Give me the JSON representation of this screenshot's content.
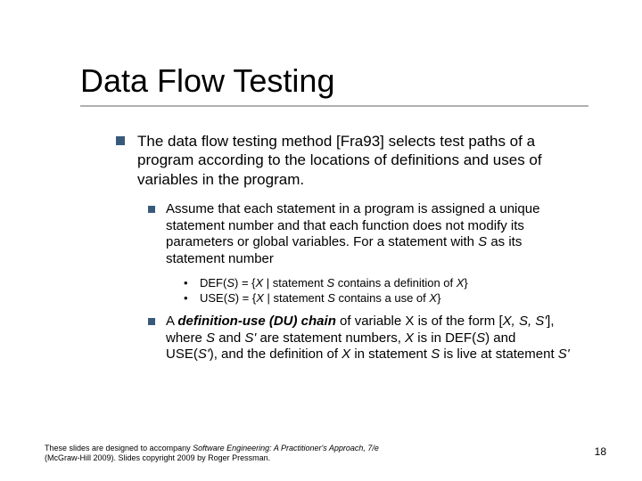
{
  "title": "Data Flow Testing",
  "body": {
    "p1": "The data flow testing method [Fra93] selects test paths of a program according to the locations of definitions and uses of variables in the program.",
    "p2_prefix": "Assume that each statement in a program is assigned a unique statement number and that each function does not modify its parameters or global variables. For a statement with ",
    "p2_S": "S",
    "p2_suffix": " as its statement number",
    "def_prefix": "DEF(",
    "def_S1": "S",
    "def_mid": ") = {",
    "def_X1": "X",
    "def_mid2": " | statement ",
    "def_S2": "S",
    "def_mid3": " contains a definition of ",
    "def_X2": "X",
    "def_end": "}",
    "use_prefix": "USE(",
    "use_S1": "S",
    "use_mid": ") = {",
    "use_X1": "X",
    "use_mid2": " | statement ",
    "use_S2": "S",
    "use_mid3": " contains a use of ",
    "use_X2": "X",
    "use_end": "}",
    "p3_a": "A ",
    "p3_term": "definition-use (DU) chain",
    "p3_b": " of variable X is of the form [",
    "p3_XSS": "X, S, S'",
    "p3_c": "], where ",
    "p3_S": "S",
    "p3_and": " and ",
    "p3_Sp": "S'",
    "p3_d": " are statement numbers, ",
    "p3_X": "X",
    "p3_e": " is in DEF(",
    "p3_S2": "S",
    "p3_f": ") and USE(",
    "p3_Sp2": "S'",
    "p3_g": "), and the definition of ",
    "p3_X2": "X",
    "p3_h": " in statement ",
    "p3_S3": "S",
    "p3_i": " is live at statement ",
    "p3_Sp3": "S'"
  },
  "footer": {
    "line1_a": "These slides are designed to accompany ",
    "line1_b": "Software Engineering: A Practitioner's Approach, 7/e",
    "line2": "(McGraw-Hill 2009). Slides copyright 2009 by Roger Pressman."
  },
  "page": "18",
  "bullets": {
    "dot": "•"
  }
}
